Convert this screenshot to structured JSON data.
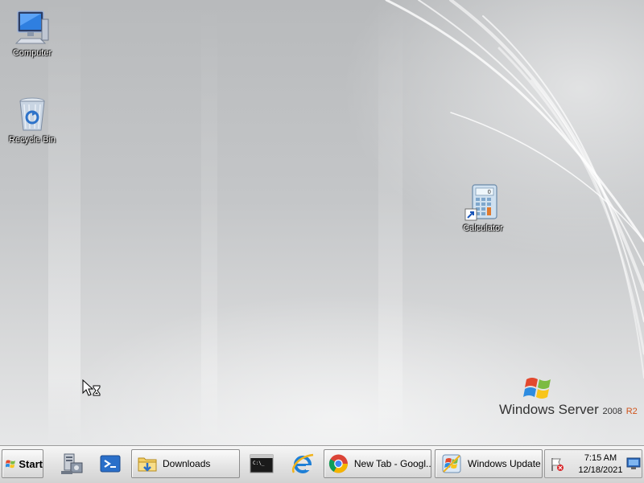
{
  "desktop": {
    "icons": [
      {
        "name": "computer-icon",
        "label": "Computer"
      },
      {
        "name": "recycle-bin-icon",
        "label": "Recycle Bin"
      },
      {
        "name": "calculator-icon",
        "label": "Calculator"
      }
    ],
    "branding": {
      "product": "Windows Server",
      "version": "2008",
      "release": "R2"
    }
  },
  "taskbar": {
    "start_label": "Start",
    "pinned": [
      {
        "name": "server-manager-icon"
      },
      {
        "name": "powershell-icon"
      }
    ],
    "tasks": [
      {
        "name": "downloads-task",
        "label": "Downloads",
        "icon": "folder-icon"
      },
      {
        "name": "cmd-task",
        "label": "",
        "icon": "cmd-icon"
      },
      {
        "name": "ie-task",
        "label": "",
        "icon": "internet-explorer-icon"
      },
      {
        "name": "chrome-task",
        "label": "New Tab - Googl...",
        "icon": "chrome-icon"
      },
      {
        "name": "windows-update-task",
        "label": "Windows Update",
        "icon": "windows-update-icon"
      }
    ],
    "tray": {
      "time": "7:15 AM",
      "date": "12/18/2021",
      "icons": [
        "action-center-flag-icon",
        "network-icon"
      ]
    }
  },
  "colors": {
    "desktop_base": "#c4c6c8",
    "taskbar": "#e3e3e3",
    "r2_accent": "#d0541a"
  }
}
